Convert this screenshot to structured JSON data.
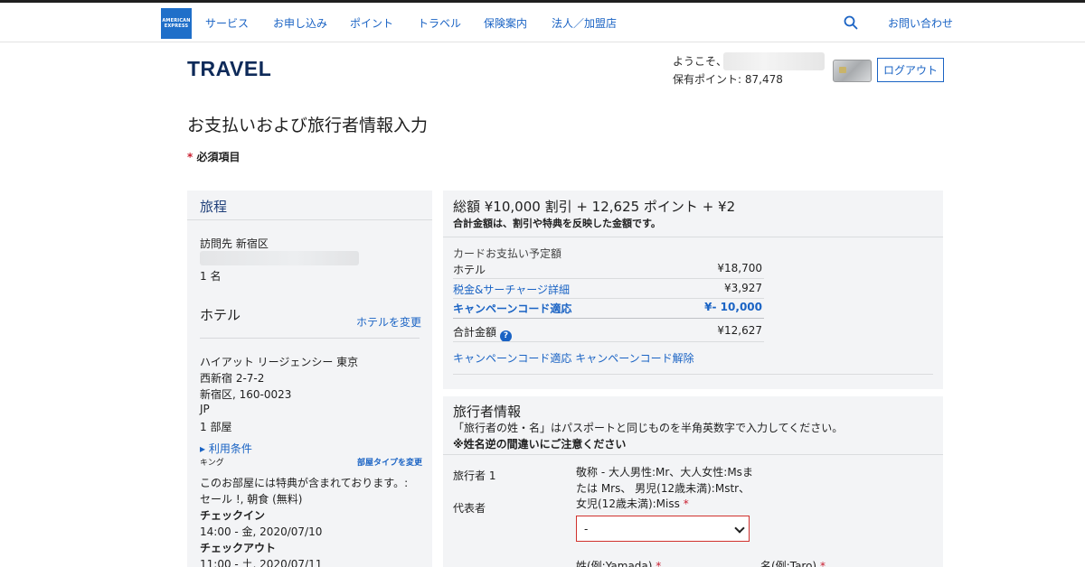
{
  "nav": {
    "logo_lines": [
      "AMERICAN",
      "EXPRESS"
    ],
    "items": [
      "サービス",
      "お申し込み",
      "ポイント",
      "トラベル",
      "保険案内",
      "法人／加盟店"
    ],
    "contact": "お問い合わせ"
  },
  "header": {
    "brand": "TRAVEL",
    "welcome": "ようこそ、",
    "points_label": "保有ポイント: 87,478",
    "logout": "ログアウト"
  },
  "page": {
    "title": "お支払いおよび旅行者情報入力",
    "required_star": "*",
    "required_text": "必須項目"
  },
  "itinerary": {
    "heading": "旅程",
    "destination": "訪問先 新宿区",
    "guests": "1 名",
    "hotel_heading": "ホテル",
    "change_hotel": "ホテルを変更",
    "hotel_name": "ハイアット リージェンシー 東京",
    "address1": "西新宿 2-7-2",
    "address2": "新宿区, 160-0023",
    "country": "JP",
    "rooms": "1 部屋",
    "terms": "▸ 利用条件",
    "room_type": "キング",
    "change_room": "部屋タイプを変更",
    "benefit1": "このお部屋には特典が含まれております。:",
    "benefit2": "セール !, 朝食 (無料)",
    "checkin_label": "チェックイン",
    "checkin_value": "14:00 - 金, 2020/07/10",
    "checkout_label": "チェックアウト",
    "checkout_value": "11:00 - 土, 2020/07/11"
  },
  "summary": {
    "title": "総額 ¥10,000 割引 + 12,625 ポイント + ¥2",
    "subtitle": "合計金額は、割引や特典を反映した金額です。",
    "card_label": "カードお支払い予定額",
    "rows": [
      {
        "label": "ホテル",
        "value": "¥18,700"
      },
      {
        "label": "税金&サーチャージ詳細",
        "value": "¥3,927"
      },
      {
        "label": "キャンペーンコード適応",
        "value": "¥- 10,000"
      }
    ],
    "total_label": "合計金額",
    "total_value": "¥12,627",
    "help": "?",
    "apply_code": "キャンペーンコード適応",
    "remove_code": "キャンペーンコード解除"
  },
  "traveler": {
    "title": "旅行者情報",
    "note1": "「旅行者の姓・名」はパスポートと同じものを半角英数字で入力してください。",
    "note2": "※姓名逆の間違いにご注意ください",
    "traveler_label": "旅行者 1",
    "representative": "代表者",
    "title_help": "敬称 - 大人男性:Mr、大人女性:Msまたは Mrs、 男児(12歳未満):Mstr、女児(12歳未満):Miss",
    "star": "*",
    "select_value": "-",
    "last_name_label": "姓(例:Yamada)",
    "first_name_label": "名(例:Taro)"
  }
}
